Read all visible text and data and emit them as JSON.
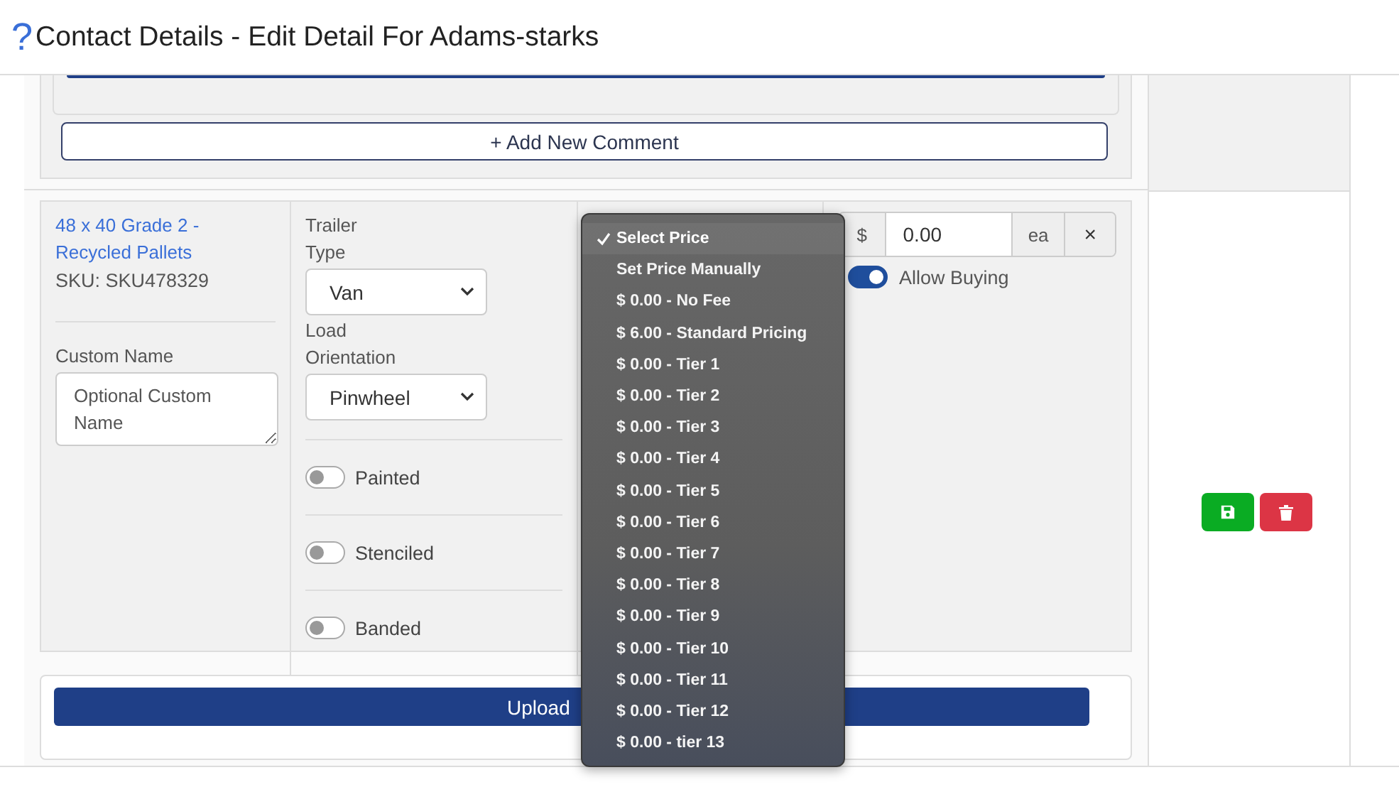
{
  "header": {
    "help_icon": "?",
    "title": "Contact Details - Edit Detail For Adams-starks"
  },
  "comments": {
    "add_button": "+ Add New Comment"
  },
  "product": {
    "name_link": "48 x 40 Grade 2 - Recycled Pallets",
    "sku": "SKU: SKU478329",
    "custom_name": {
      "label": "Custom Name",
      "placeholder": "Optional Custom Name"
    },
    "trailer_type": {
      "label": "Trailer Type",
      "value": "Van"
    },
    "load_orientation": {
      "label": "Load Orientation",
      "value": "Pinwheel"
    },
    "toggles": [
      {
        "label": "Painted",
        "on": false
      },
      {
        "label": "Stenciled",
        "on": false
      },
      {
        "label": "Banded",
        "on": false
      }
    ],
    "price": {
      "currency": "$",
      "value": "0.00",
      "unit": "ea",
      "clear": "×"
    },
    "allow_buying": {
      "label": "Allow Buying",
      "on": true
    }
  },
  "upload_button": "Upload",
  "actions": [
    {
      "kind": "save"
    },
    {
      "kind": "delete"
    }
  ],
  "price_menu": [
    {
      "label": "Select Price",
      "selected": true
    },
    {
      "label": "Set Price Manually",
      "selected": false
    },
    {
      "label": "$ 0.00 - No Fee",
      "selected": false
    },
    {
      "label": "$ 6.00 - Standard Pricing",
      "selected": false
    },
    {
      "label": "$ 0.00 - Tier 1",
      "selected": false
    },
    {
      "label": "$ 0.00 - Tier 2",
      "selected": false
    },
    {
      "label": "$ 0.00 - Tier 3",
      "selected": false
    },
    {
      "label": "$ 0.00 - Tier 4",
      "selected": false
    },
    {
      "label": "$ 0.00 - Tier 5",
      "selected": false
    },
    {
      "label": "$ 0.00 - Tier 6",
      "selected": false
    },
    {
      "label": "$ 0.00 - Tier 7",
      "selected": false
    },
    {
      "label": "$ 0.00 - Tier 8",
      "selected": false
    },
    {
      "label": "$ 0.00 - Tier 9",
      "selected": false
    },
    {
      "label": "$ 0.00 - Tier 10",
      "selected": false
    },
    {
      "label": "$ 0.00 - Tier 11",
      "selected": false
    },
    {
      "label": "$ 0.00 - Tier 12",
      "selected": false
    },
    {
      "label": "$ 0.00 - tier 13",
      "selected": false
    }
  ]
}
